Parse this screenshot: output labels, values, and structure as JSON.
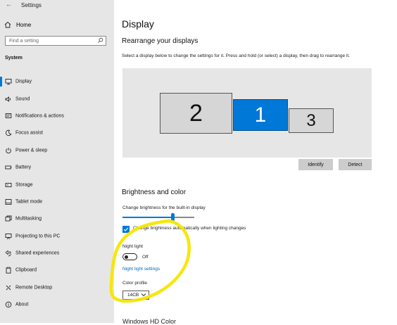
{
  "window": {
    "title": "Settings"
  },
  "sidebar": {
    "home_label": "Home",
    "search_placeholder": "Find a setting",
    "section_label": "System",
    "items": [
      {
        "label": "Display",
        "icon": "monitor-icon",
        "active": true
      },
      {
        "label": "Sound",
        "icon": "speaker-icon"
      },
      {
        "label": "Notifications & actions",
        "icon": "notification-icon"
      },
      {
        "label": "Focus assist",
        "icon": "moon-icon"
      },
      {
        "label": "Power & sleep",
        "icon": "power-icon"
      },
      {
        "label": "Battery",
        "icon": "battery-icon"
      },
      {
        "label": "Storage",
        "icon": "storage-icon"
      },
      {
        "label": "Tablet mode",
        "icon": "tablet-icon"
      },
      {
        "label": "Multitasking",
        "icon": "multitasking-icon"
      },
      {
        "label": "Projecting to this PC",
        "icon": "projecting-icon"
      },
      {
        "label": "Shared experiences",
        "icon": "shared-icon"
      },
      {
        "label": "Clipboard",
        "icon": "clipboard-icon"
      },
      {
        "label": "Remote Desktop",
        "icon": "remote-desktop-icon"
      },
      {
        "label": "About",
        "icon": "info-icon"
      }
    ]
  },
  "main": {
    "title": "Display",
    "rearrange": {
      "heading": "Rearrange your displays",
      "description": "Select a display below to change the settings for it. Press and hold (or select) a display, then drag to rearrange it.",
      "monitors": [
        "2",
        "1",
        "3"
      ],
      "selected": "1",
      "identify_label": "Identify",
      "detect_label": "Detect"
    },
    "brightness": {
      "heading": "Brightness and color",
      "slider_label": "Change brightness for the built-in display",
      "slider_value_percent": 70,
      "auto_checkbox_label": "Change brightness automatically when lighting changes",
      "auto_checked": true,
      "night_light_label": "Night light",
      "night_light_state": "Off",
      "night_light_link": "Night light settings",
      "color_profile_label": "Color profile",
      "color_profile_value": "14CB"
    },
    "next_heading_partial": "Windows HD Color"
  },
  "colors": {
    "accent": "#0078d7",
    "link": "#0067c0",
    "sidebar_bg": "#e6e6e6",
    "annotation": "#f5e600"
  }
}
